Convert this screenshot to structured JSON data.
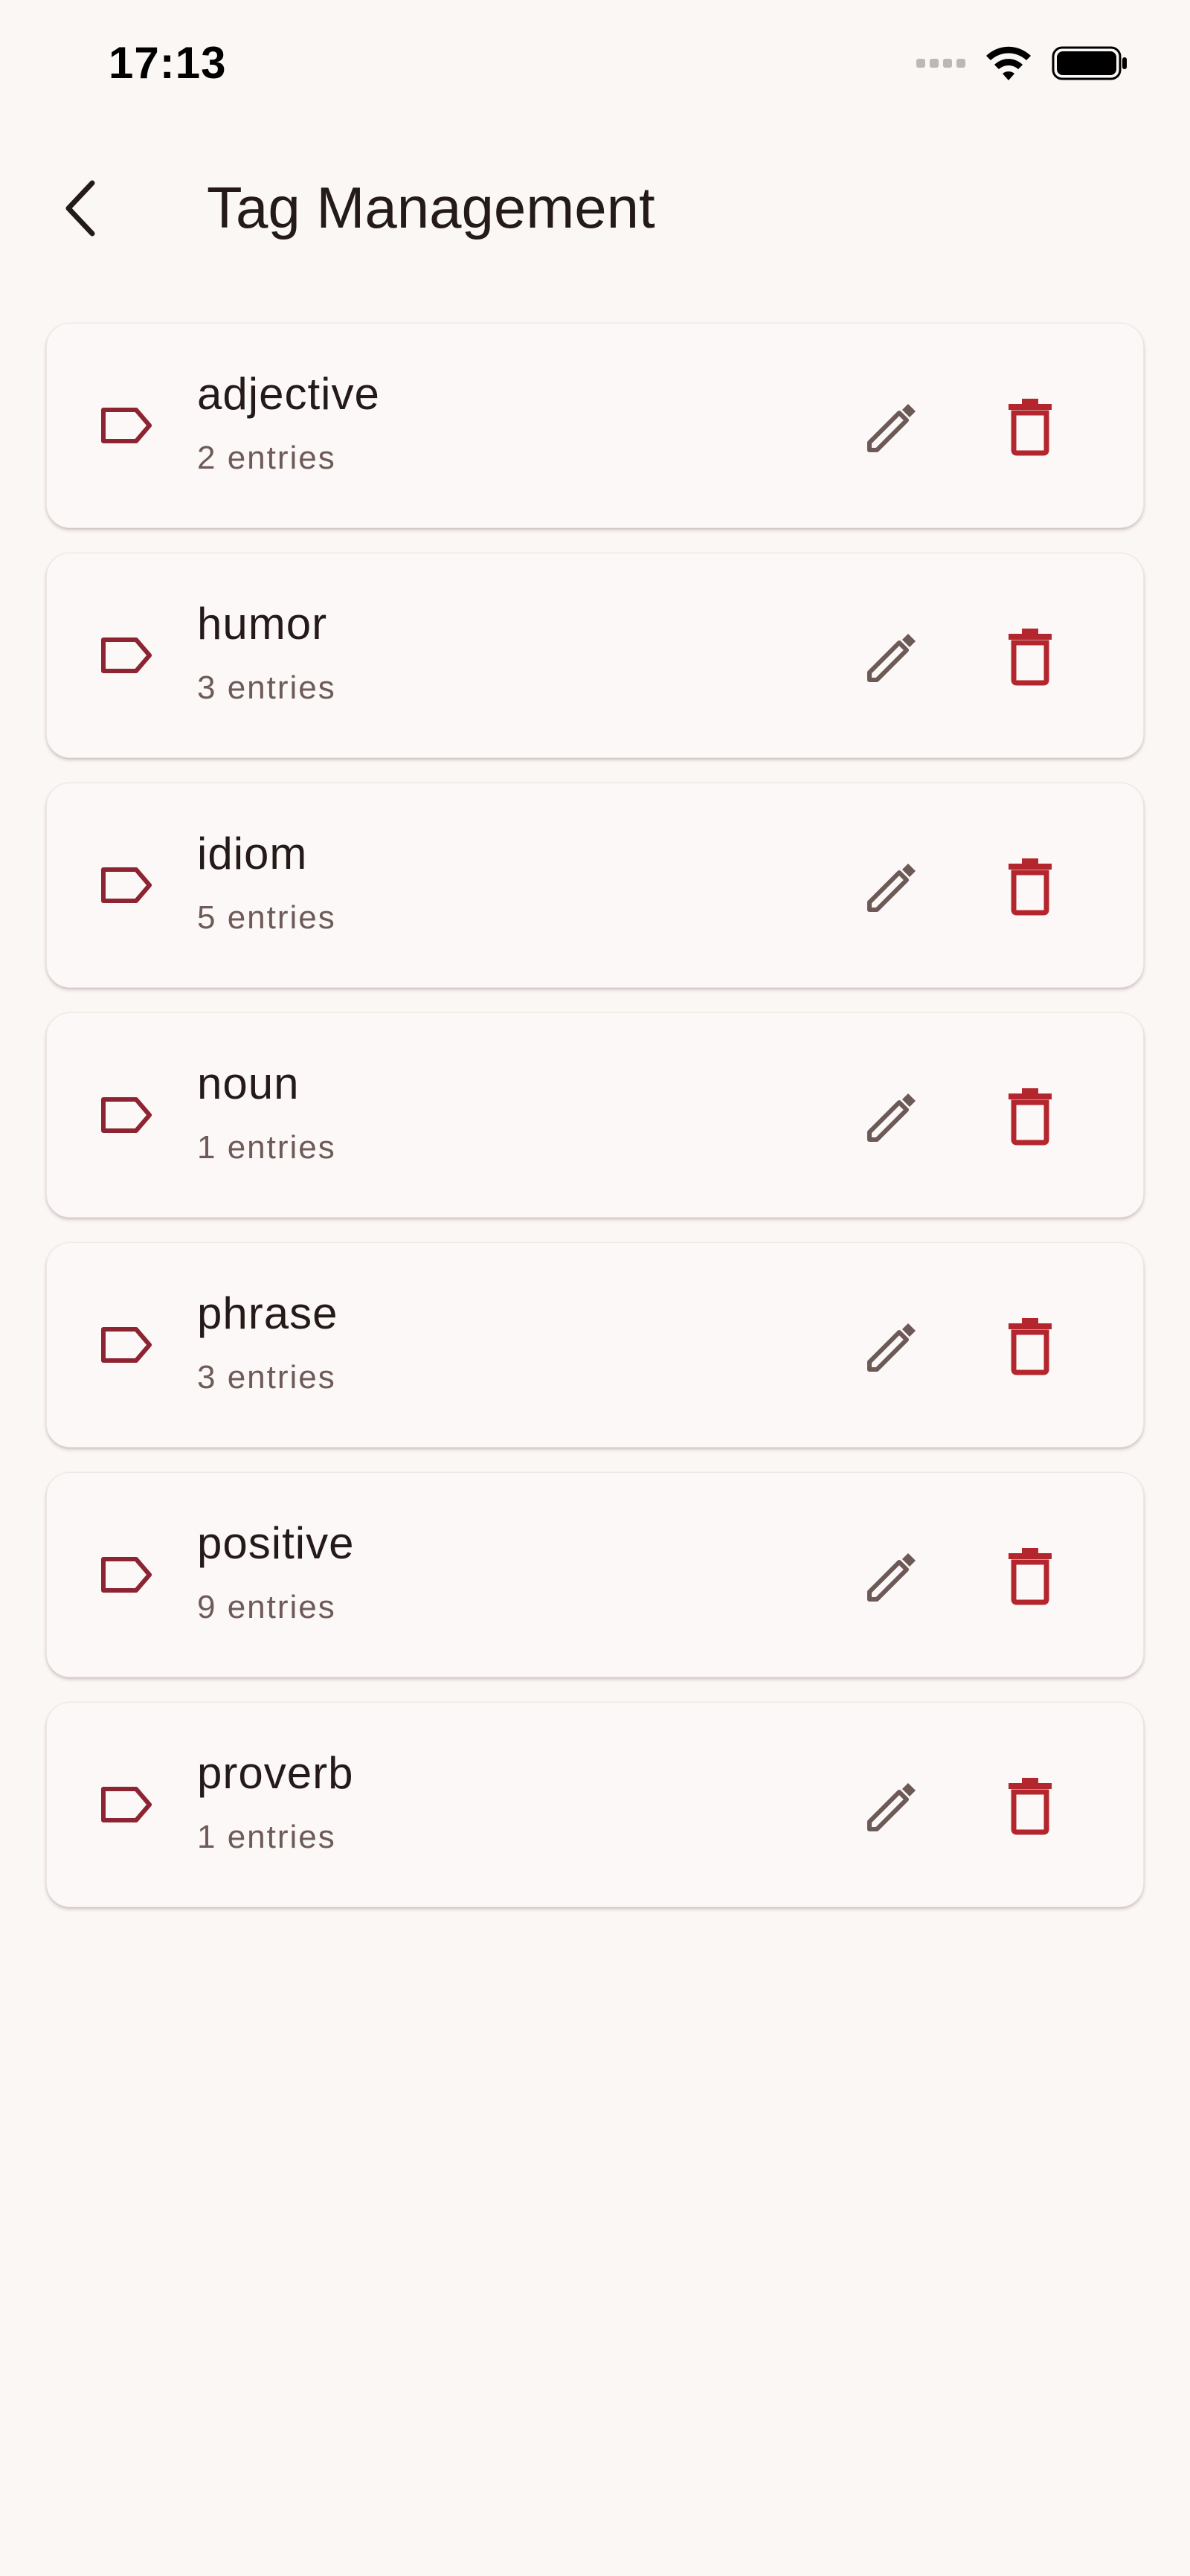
{
  "status_bar": {
    "time": "17:13"
  },
  "app_bar": {
    "title": "Tag Management"
  },
  "colors": {
    "background": "#fbf7f5",
    "tag_icon": "#8c2432",
    "edit_icon": "#6d5a57",
    "delete_icon": "#b3262d",
    "text_primary": "#241a19",
    "text_secondary": "#6e5b58"
  },
  "icons": {
    "back": "chevron-left-icon",
    "tag": "label-outline-icon",
    "edit": "pencil-icon",
    "delete": "trash-icon"
  },
  "tags": [
    {
      "name": "adjective",
      "count": "2 entries"
    },
    {
      "name": "humor",
      "count": "3 entries"
    },
    {
      "name": "idiom",
      "count": "5 entries"
    },
    {
      "name": "noun",
      "count": "1 entries"
    },
    {
      "name": "phrase",
      "count": "3 entries"
    },
    {
      "name": "positive",
      "count": "9 entries"
    },
    {
      "name": "proverb",
      "count": "1 entries"
    }
  ]
}
